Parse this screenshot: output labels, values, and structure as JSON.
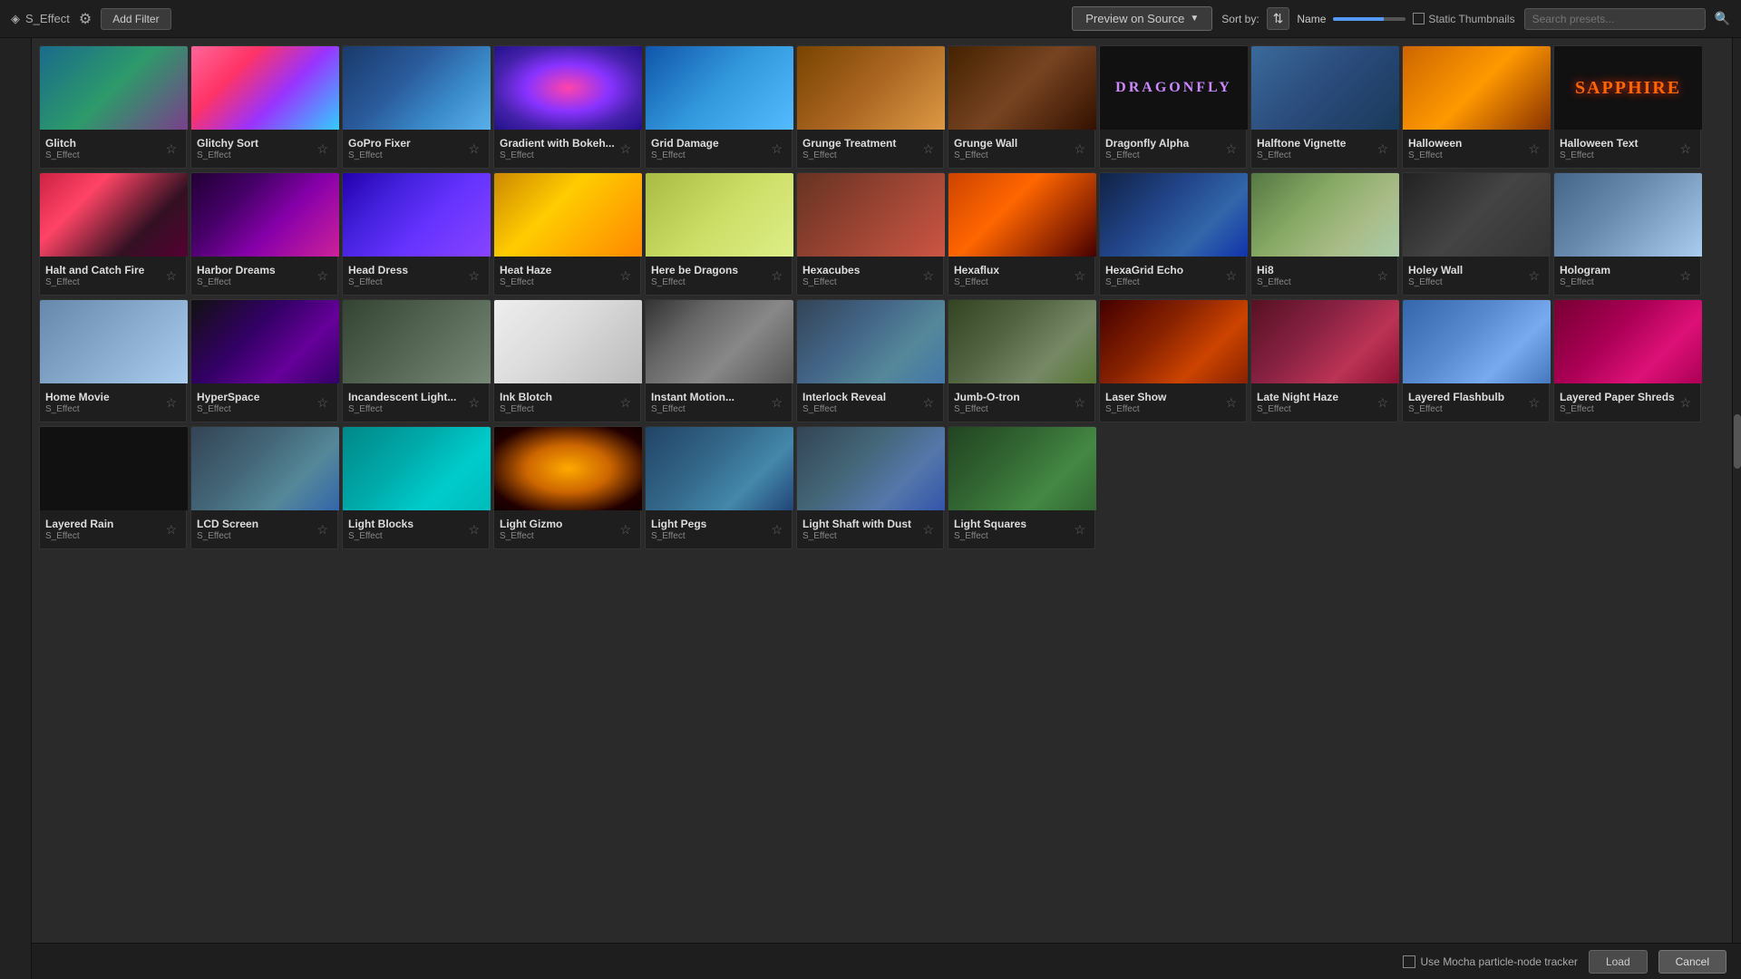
{
  "toolbar": {
    "app_label": "S_Effect",
    "settings_label": "⚙",
    "add_filter_label": "Add Filter",
    "preview_label": "Preview on Source",
    "sort_label": "Sort by:",
    "sort_icon": "⇅",
    "name_label": "Name",
    "static_thumb_label": "Static Thumbnails",
    "search_placeholder": "Search presets..."
  },
  "bottom_bar": {
    "use_plugin_label": "Use Mocha particle-node tracker",
    "apply_label": "Load",
    "cancel_label": "Cancel"
  },
  "effects": [
    {
      "name": "Glitch",
      "type": "S_Effect",
      "thumb": "glitch",
      "starred": false
    },
    {
      "name": "Glitchy Sort",
      "type": "S_Effect",
      "thumb": "glitchy-sort",
      "starred": false
    },
    {
      "name": "GoPro Fixer",
      "type": "S_Effect",
      "thumb": "gopro",
      "starred": false
    },
    {
      "name": "Gradient with Bokeh...",
      "type": "S_Effect",
      "thumb": "gradient-bokeh",
      "starred": false
    },
    {
      "name": "Grid Damage",
      "type": "S_Effect",
      "thumb": "grid-damage",
      "starred": false
    },
    {
      "name": "Grunge Treatment",
      "type": "S_Effect",
      "thumb": "grunge-treatment",
      "starred": false
    },
    {
      "name": "Grunge Wall",
      "type": "S_Effect",
      "thumb": "grunge-wall",
      "starred": false
    },
    {
      "name": "Dragonfly Alpha",
      "type": "S_Effect",
      "thumb": "dragonfly",
      "starred": false
    },
    {
      "name": "Halftone Vignette",
      "type": "S_Effect",
      "thumb": "halftone",
      "starred": false
    },
    {
      "name": "Halloween",
      "type": "S_Effect",
      "thumb": "halloween",
      "starred": false
    },
    {
      "name": "Halloween Text",
      "type": "S_Effect",
      "thumb": "halloween-text",
      "starred": false
    },
    {
      "name": "Halt and Catch Fire",
      "type": "S_Effect",
      "thumb": "halt-catch",
      "starred": false
    },
    {
      "name": "Harbor Dreams",
      "type": "S_Effect",
      "thumb": "harbor-dreams",
      "starred": false
    },
    {
      "name": "Head Dress",
      "type": "S_Effect",
      "thumb": "head-dress",
      "starred": false
    },
    {
      "name": "Heat Haze",
      "type": "S_Effect",
      "thumb": "heat-haze",
      "starred": false
    },
    {
      "name": "Here be Dragons",
      "type": "S_Effect",
      "thumb": "here-dragons",
      "starred": false
    },
    {
      "name": "Hexacubes",
      "type": "S_Effect",
      "thumb": "hexacubes",
      "starred": false
    },
    {
      "name": "Hexaflux",
      "type": "S_Effect",
      "thumb": "hexaflux",
      "starred": false
    },
    {
      "name": "HexaGrid Echo",
      "type": "S_Effect",
      "thumb": "hexagrid",
      "starred": false
    },
    {
      "name": "Hi8",
      "type": "S_Effect",
      "thumb": "hi8",
      "starred": false
    },
    {
      "name": "Holey Wall",
      "type": "S_Effect",
      "thumb": "holey-wall",
      "starred": false
    },
    {
      "name": "Hologram",
      "type": "S_Effect",
      "thumb": "hologram",
      "starred": false
    },
    {
      "name": "Home Movie",
      "type": "S_Effect",
      "thumb": "home-movie",
      "starred": false
    },
    {
      "name": "HyperSpace",
      "type": "S_Effect",
      "thumb": "hyperspace",
      "starred": false
    },
    {
      "name": "Incandescent Light...",
      "type": "S_Effect",
      "thumb": "incandescent",
      "starred": false
    },
    {
      "name": "Ink Blotch",
      "type": "S_Effect",
      "thumb": "ink-blotch",
      "starred": false
    },
    {
      "name": "Instant Motion...",
      "type": "S_Effect",
      "thumb": "instant-motion",
      "starred": false
    },
    {
      "name": "Interlock Reveal",
      "type": "S_Effect",
      "thumb": "interlock",
      "starred": false
    },
    {
      "name": "Jumb-O-tron",
      "type": "S_Effect",
      "thumb": "jumb-o-tron",
      "starred": false
    },
    {
      "name": "Laser Show",
      "type": "S_Effect",
      "thumb": "laser-show",
      "starred": false
    },
    {
      "name": "Late Night Haze",
      "type": "S_Effect",
      "thumb": "late-night",
      "starred": false
    },
    {
      "name": "Layered Flashbulb",
      "type": "S_Effect",
      "thumb": "layered-flash",
      "starred": false
    },
    {
      "name": "Layered Paper Shreds",
      "type": "S_Effect",
      "thumb": "layered-paper",
      "starred": false
    },
    {
      "name": "Layered Rain",
      "type": "S_Effect",
      "thumb": "layered-rain",
      "starred": false
    },
    {
      "name": "LCD Screen",
      "type": "S_Effect",
      "thumb": "lcd",
      "starred": false
    },
    {
      "name": "Light Blocks",
      "type": "S_Effect",
      "thumb": "light-blocks",
      "starred": false
    },
    {
      "name": "Light Gizmo",
      "type": "S_Effect",
      "thumb": "light-gizmo",
      "starred": false
    },
    {
      "name": "Light Pegs",
      "type": "S_Effect",
      "thumb": "light-pegs",
      "starred": false
    },
    {
      "name": "Light Shaft with Dust",
      "type": "S_Effect",
      "thumb": "light-shaft",
      "starred": false
    },
    {
      "name": "Light Squares",
      "type": "S_Effect",
      "thumb": "light-squares",
      "starred": false
    }
  ]
}
